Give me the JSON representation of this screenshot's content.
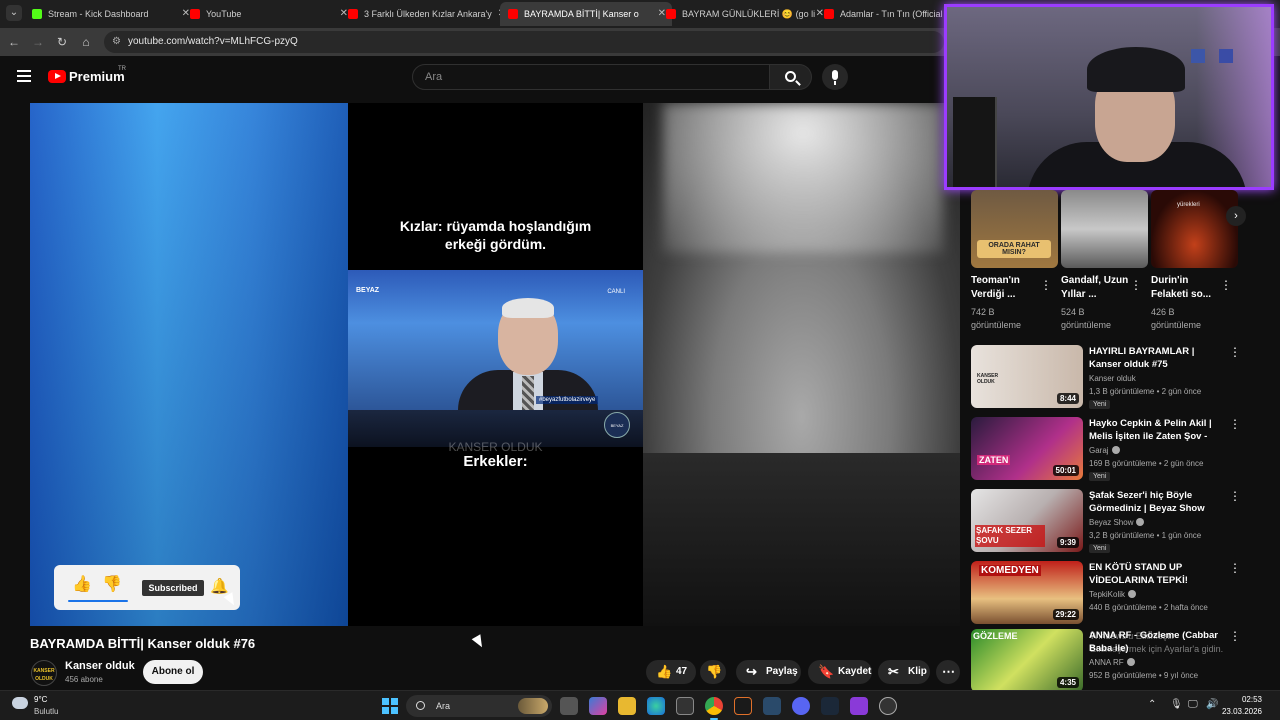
{
  "browser": {
    "tabs": [
      {
        "label": "Stream - Kick Dashboard",
        "favicon_color": "#53fc18",
        "active": false
      },
      {
        "label": "YouTube",
        "favicon_color": "#ff0000",
        "active": false
      },
      {
        "label": "3 Farklı Ülkeden Kızlar Ankara'y",
        "favicon_color": "#ff0000",
        "active": false
      },
      {
        "label": "BAYRAMDA BİTTİ| Kanser o",
        "favicon_color": "#ff0000",
        "active": true
      },
      {
        "label": "BAYRAM GÜNLÜKLERİ 😊 (go li",
        "favicon_color": "#ff0000",
        "active": false
      },
      {
        "label": "Adamlar - Tın Tın (Official Aud",
        "favicon_color": "#ff0000",
        "active": false
      }
    ],
    "url": "youtube.com/watch?v=MLhFCG-pzyQ"
  },
  "header": {
    "brand": "Premium",
    "region": "TR",
    "search_placeholder": "Ara"
  },
  "video": {
    "caption_top": "Kızlar: rüyamda hoşlandığım erkeği gördüm.",
    "caption_bottom": "Erkekler:",
    "watermark": "KANSER OLDUK",
    "broadcaster": "BEYAZ",
    "live_label": "CANLI",
    "hashtag": "#beyazfutbolazirveye",
    "channel_logo": "BEYAZ FUTBOL"
  },
  "overlay": {
    "subscribed_label": "Subscribed"
  },
  "meta": {
    "title": "BAYRAMDA BİTTİ| Kanser olduk #76",
    "channel": "Kanser olduk",
    "avatar_text": "KANSER OLDUK",
    "subscribers": "456 abone",
    "subscribe_label": "Abone ol",
    "likes": "47",
    "share_label": "Paylaş",
    "save_label": "Kaydet",
    "clip_label": "Klip"
  },
  "shorts": [
    {
      "title": "Teoman'ın Verdiği ...",
      "views": "742 B görüntüleme",
      "overlay_text": "ORADA RAHAT MISIN?"
    },
    {
      "title": "Gandalf, Uzun Yıllar ...",
      "views": "524 B görüntüleme",
      "overlay_text": ""
    },
    {
      "title": "Durin'in Felaketi so...",
      "views": "426 B görüntüleme",
      "overlay_text": "yürekleri"
    }
  ],
  "recommendations": [
    {
      "title": "HAYIRLI BAYRAMLAR | Kanser olduk #75",
      "channel": "Kanser olduk",
      "verified": false,
      "meta": "1,3 B görüntüleme • 2 gün önce",
      "badge": "Yeni",
      "duration": "8:44",
      "thumb_text": "KANSER OLDUK"
    },
    {
      "title": "Hayko Cepkin & Pelin Akil | Melis İşiten ile Zaten Şov - 13...",
      "channel": "Garaj",
      "verified": true,
      "meta": "169 B görüntüleme • 2 gün önce",
      "badge": "Yeni",
      "duration": "50:01",
      "thumb_text": "ZATEN"
    },
    {
      "title": "Şafak Sezer'i hiç Böyle Görmediniz | Beyaz Show",
      "channel": "Beyaz Show",
      "verified": true,
      "meta": "3,2 B görüntüleme • 1 gün önce",
      "badge": "Yeni",
      "duration": "9:39",
      "thumb_text": "ŞAFAK SEZER ŞOVU"
    },
    {
      "title": "EN KÖTÜ STAND UP VİDEOLARINA TEPKİ!",
      "channel": "TepkiKolik",
      "verified": true,
      "meta": "440 B görüntüleme • 2 hafta önce",
      "badge": "",
      "duration": "29:22",
      "thumb_text": "KOMEDYEN"
    },
    {
      "title": "ANNA RF - Gözleme (Cabbar Baba ile)",
      "channel": "ANNA RF",
      "verified": true,
      "meta": "952 B görüntüleme • 9 yıl önce",
      "badge": "",
      "duration": "4:35",
      "thumb_text": "GÖZLEME"
    }
  ],
  "activation_overlay": "Windows'u Etkinleştir\nEtkinleştirmek için Ayarlar'a gidin.",
  "taskbar": {
    "temp": "9°C",
    "weather": "Bulutlu",
    "search_label": "Ara",
    "time": "02:53",
    "date": "23.03.2026"
  },
  "colors": {
    "accent_purple": "#9b3cff",
    "yt_red": "#ff0000",
    "link_blue": "#1a73e8"
  }
}
